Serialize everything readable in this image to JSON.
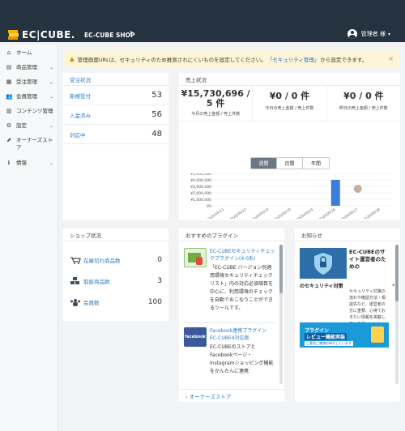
{
  "header": {
    "logo_text": "EC|CUBE.",
    "shop_name": "EC-CUBE SHOP",
    "shop_chevron": "›",
    "user_name": "管理者 様",
    "user_caret": "▾"
  },
  "sidebar": {
    "items": [
      {
        "icon": "⌂",
        "label": "ホーム",
        "chevron": ""
      },
      {
        "icon": "▤",
        "label": "商品管理",
        "chevron": "⌄"
      },
      {
        "icon": "▦",
        "label": "受注管理",
        "chevron": "⌄"
      },
      {
        "icon": "👥",
        "label": "会員管理",
        "chevron": "⌄"
      },
      {
        "icon": "▥",
        "label": "コンテンツ管理",
        "chevron": "⌄"
      },
      {
        "icon": "⚙",
        "label": "設定",
        "chevron": "⌄"
      },
      {
        "icon": "⬈",
        "label": "オーナーズストア",
        "chevron": "⌄"
      },
      {
        "icon": "ℹ",
        "label": "情報",
        "chevron": "⌄"
      }
    ]
  },
  "alert": {
    "icon": "▲",
    "text_before": "管理画面URLは、セキュリティのため推測されにくいものを設定してください。",
    "link": "「セキュリティ管理」",
    "text_after": "から設定できます。",
    "close": "×"
  },
  "order_status": {
    "title": "受注状況",
    "rows": [
      {
        "label": "新規受付",
        "value": "53"
      },
      {
        "label": "入金済み",
        "value": "56"
      },
      {
        "label": "対応中",
        "value": "48"
      }
    ]
  },
  "sales": {
    "title": "売上状況",
    "cols": [
      {
        "amount_line1": "¥15,730,696 /",
        "amount_line2": "5 件",
        "sub": "今月の売上金額 / 売上件数"
      },
      {
        "amount_line1": "¥0 / 0 件",
        "amount_line2": "",
        "sub": "今日の売上金額 / 売上件数"
      },
      {
        "amount_line1": "¥0 / 0 件",
        "amount_line2": "",
        "sub": "昨日の売上金額 / 売上件数"
      }
    ],
    "tabs": [
      "週間",
      "月間",
      "年間"
    ],
    "active_tab": "週間"
  },
  "chart_data": {
    "type": "bar",
    "categories": [
      "2020/05/11",
      "2020/05/12",
      "2020/05/13",
      "2020/05/14",
      "2020/05/15",
      "2020/05/16",
      "2020/05/17",
      "2020/05/18"
    ],
    "values": [
      0,
      0,
      0,
      0,
      0,
      4000000,
      0,
      0
    ],
    "ylim": [
      0,
      5000000
    ],
    "yticks": [
      "¥5,000,000",
      "¥4,000,000",
      "¥3,000,000",
      "¥2,000,000",
      "¥1,000,000",
      "¥0"
    ],
    "bar_color": "#3b7dd8",
    "grid": true
  },
  "shop_status": {
    "title": "ショップ状況",
    "rows": [
      {
        "label": "在庫切れ商品数",
        "value": "0"
      },
      {
        "label": "取扱商品数",
        "value": "3"
      },
      {
        "label": "会員数",
        "value": "100"
      }
    ]
  },
  "plugins": {
    "title": "おすすめのプラグイン",
    "items": [
      {
        "title": "EC-CUBEセキュリティチェックプラグイン(4.0系)",
        "desc": "「EC-CUBE バージョン別適用環境セキュリティチェックリスト」内の対応必須項目を中心に、利用環境のチェックを自動でおこなうことができるツールです。",
        "thumb_color": "#6fae3f"
      },
      {
        "title": "Facebook連携プラグイン EC-CUBE4対応版",
        "desc": "EC-CUBEのストアとFacebookページ・Instagramショッピング機能をかんたんに連携",
        "thumb_color": "#3b5998",
        "thumb_text": "facebook"
      }
    ],
    "footer": "› オーナーズストア"
  },
  "news": {
    "title": "お知らせ",
    "item_title": "EC-CUBEのサイト運営者のための",
    "item_subtitle": "のセキュリティ対策",
    "item_desc": "セキュリティ対策の流れや確認方法・相談先など、運営者の方に重要、心得ておきたい情報を掲載しています。",
    "chevron": "›",
    "banner_line1": "プラグイン",
    "banner_line2": "レビュー機能実装",
    "banner_line3": "ご意見ご感想お待ちしています"
  }
}
